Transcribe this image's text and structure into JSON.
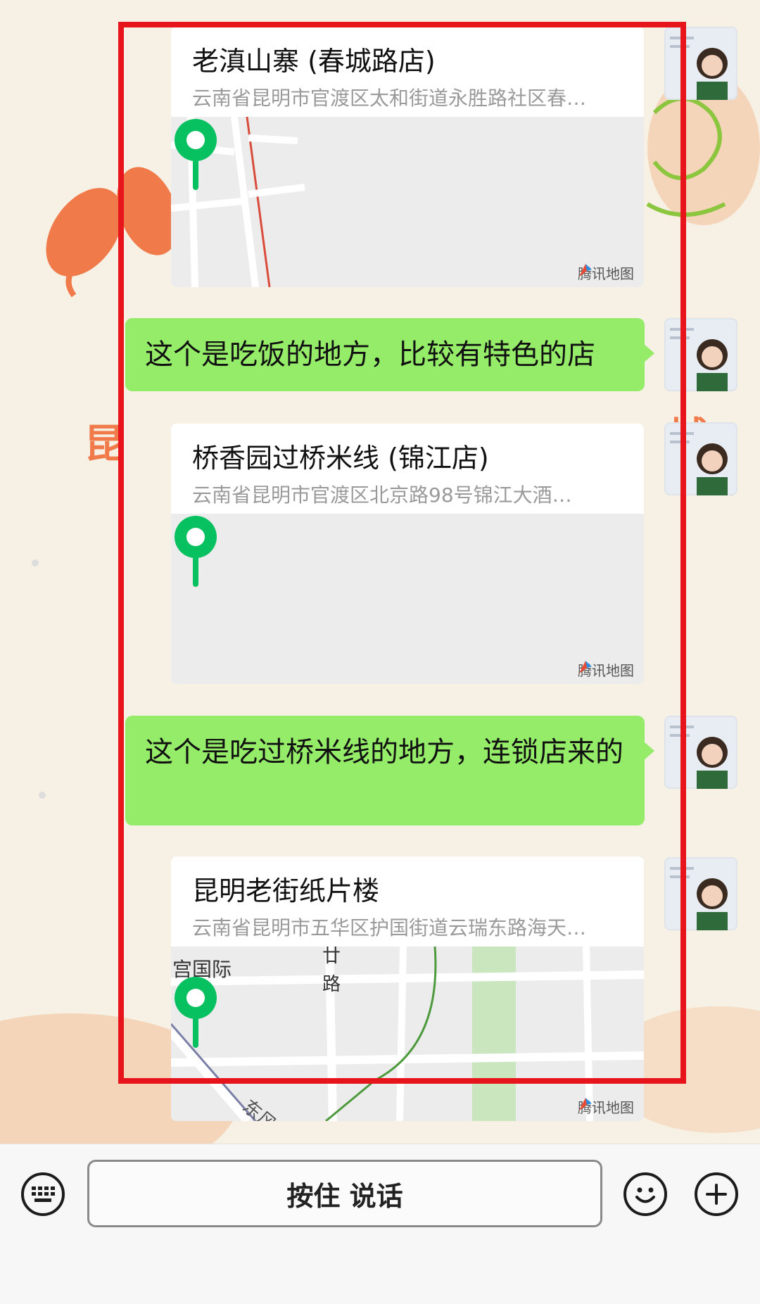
{
  "messages": [
    {
      "type": "location",
      "name": "老滇山寨 (春城路店)",
      "address": "云南省昆明市官渡区太和街道永胜路社区春…",
      "map_brand": "腾讯地图"
    },
    {
      "type": "text",
      "text": "这个是吃饭的地方，比较有特色的店"
    },
    {
      "type": "location",
      "name": "桥香园过桥米线 (锦江店)",
      "address": "云南省昆明市官渡区北京路98号锦江大酒…",
      "map_brand": "腾讯地图"
    },
    {
      "type": "text",
      "text": "这个是吃过桥米线的地方，连锁店来的"
    },
    {
      "type": "location",
      "name": "昆明老街纸片楼",
      "address": "云南省昆明市五华区护国街道云瑞东路海天…",
      "map_brand": "腾讯地图",
      "map_labels": [
        "宫国际",
        "廿",
        "路",
        "东风"
      ]
    }
  ],
  "input_bar": {
    "hold_to_talk": "按住 说话",
    "keyboard_icon": "keyboard-icon",
    "emoji_icon": "emoji-icon",
    "plus_icon": "plus-icon"
  },
  "colors": {
    "bubble": "#95ec69",
    "pin": "#07c160",
    "highlight": "#e8141b",
    "background": "#f6f1e4"
  }
}
